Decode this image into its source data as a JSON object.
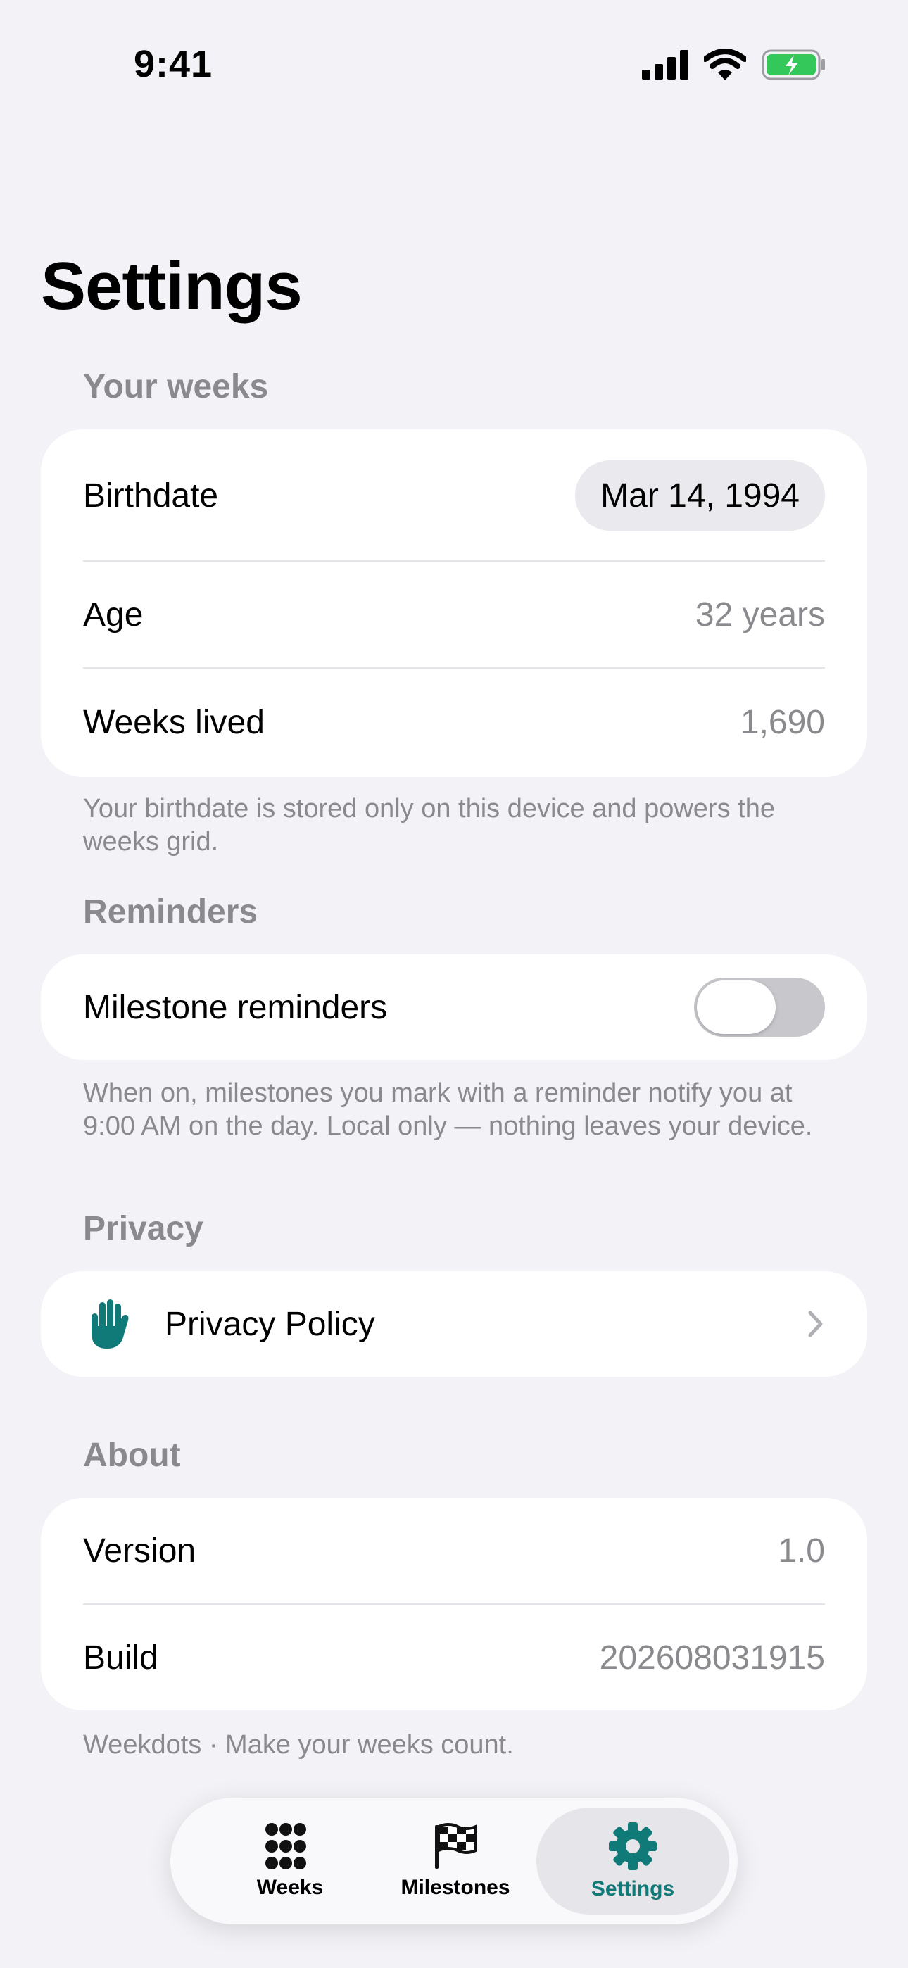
{
  "status": {
    "time": "9:41"
  },
  "page": {
    "title": "Settings"
  },
  "your_weeks": {
    "header": "Your weeks",
    "birthdate_label": "Birthdate",
    "birthdate_value": "Mar 14, 1994",
    "age_label": "Age",
    "age_value": "32 years",
    "weeks_label": "Weeks lived",
    "weeks_value": "1,690",
    "footer": "Your birthdate is stored only on this device and powers the weeks grid."
  },
  "reminders": {
    "header": "Reminders",
    "milestone_label": "Milestone reminders",
    "toggle_on": false,
    "footer": "When on, milestones you mark with a reminder notify you at 9:00 AM on the day. Local only — nothing leaves your device."
  },
  "privacy": {
    "header": "Privacy",
    "policy_label": "Privacy Policy",
    "icon": "hand-raised-icon"
  },
  "about": {
    "header": "About",
    "version_label": "Version",
    "version_value": "1.0",
    "build_label": "Build",
    "build_value": "202608031915",
    "footer": "Weekdots · Make your weeks count."
  },
  "tabs": [
    {
      "label": "Weeks",
      "icon": "grid-dots-icon",
      "active": false
    },
    {
      "label": "Milestones",
      "icon": "checkered-flag-icon",
      "active": false
    },
    {
      "label": "Settings",
      "icon": "gear-icon",
      "active": true
    }
  ],
  "colors": {
    "accent": "#0f7a78",
    "background": "#f2f2f7",
    "secondary_text": "#8a8a8e"
  }
}
